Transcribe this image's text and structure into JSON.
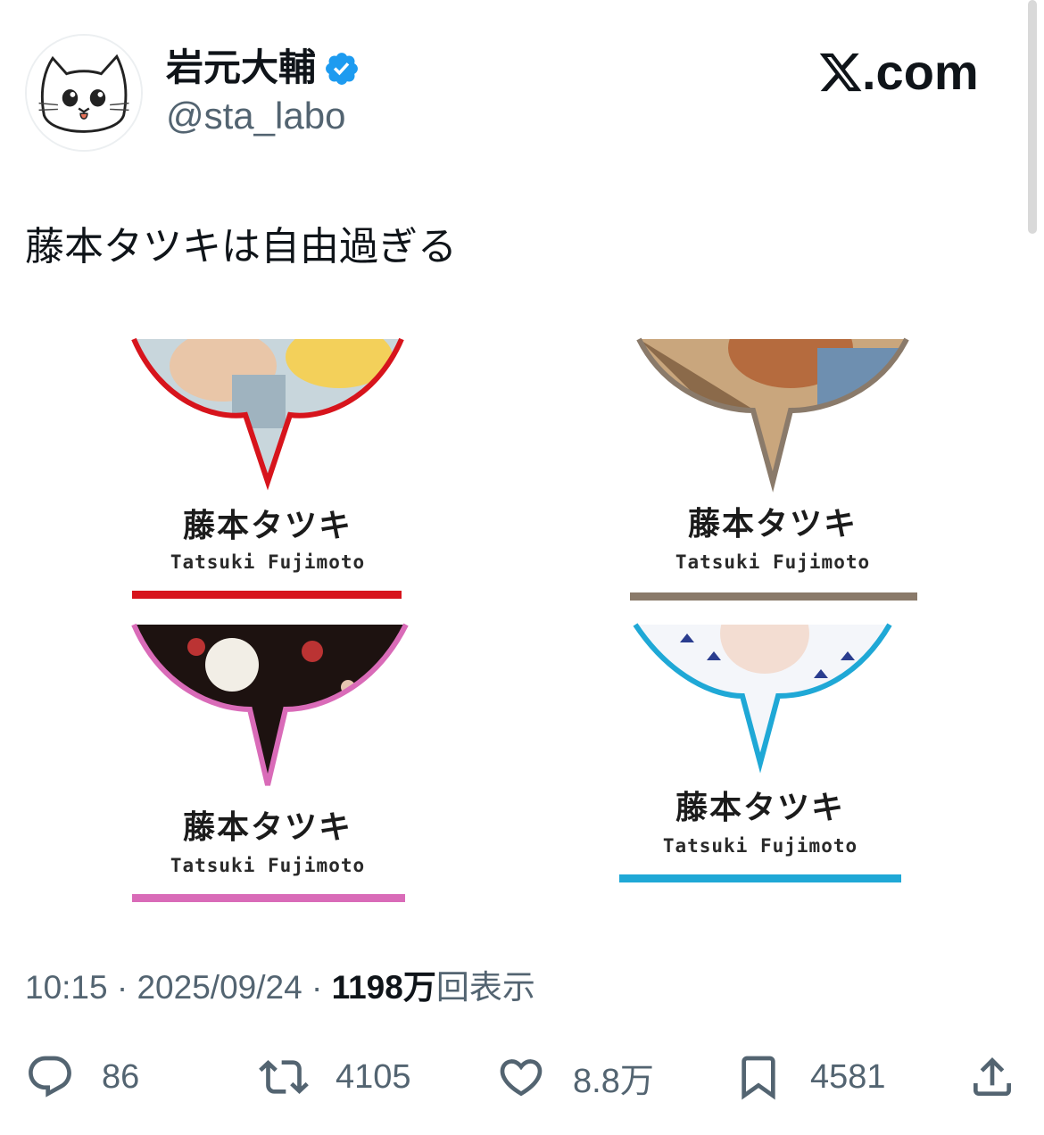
{
  "author": {
    "display_name": "岩元大輔",
    "handle": "@sta_labo",
    "avatar_icon": "cat-face-icon",
    "verified_icon": "verified-badge-icon",
    "verified_color": "#1d9bf0"
  },
  "brand": {
    "icon": "x-logo-icon",
    "label": ".com"
  },
  "tweet": {
    "text": "藤本タツキは自由過ぎる"
  },
  "media": {
    "cards": [
      {
        "name_jp": "藤本タツキ",
        "name_en": "Tatsuki Fujimoto",
        "accent": "#d7141c"
      },
      {
        "name_jp": "藤本タツキ",
        "name_en": "Tatsuki Fujimoto",
        "accent": "#8a7a6a"
      },
      {
        "name_jp": "藤本タツキ",
        "name_en": "Tatsuki Fujimoto",
        "accent": "#d96bb8"
      },
      {
        "name_jp": "藤本タツキ",
        "name_en": "Tatsuki Fujimoto",
        "accent": "#1fa8d6"
      }
    ]
  },
  "meta": {
    "time": "10:15",
    "separator": "·",
    "date": "2025/09/24",
    "views_number": "1198",
    "views_unit": "万",
    "views_label": "回表示"
  },
  "actions": {
    "reply": {
      "icon": "reply-icon",
      "count": "86"
    },
    "retweet": {
      "icon": "retweet-icon",
      "count": "4105"
    },
    "like": {
      "icon": "heart-icon",
      "count": "8.8万"
    },
    "bookmark": {
      "icon": "bookmark-icon",
      "count": "4581"
    },
    "share": {
      "icon": "share-icon"
    }
  }
}
